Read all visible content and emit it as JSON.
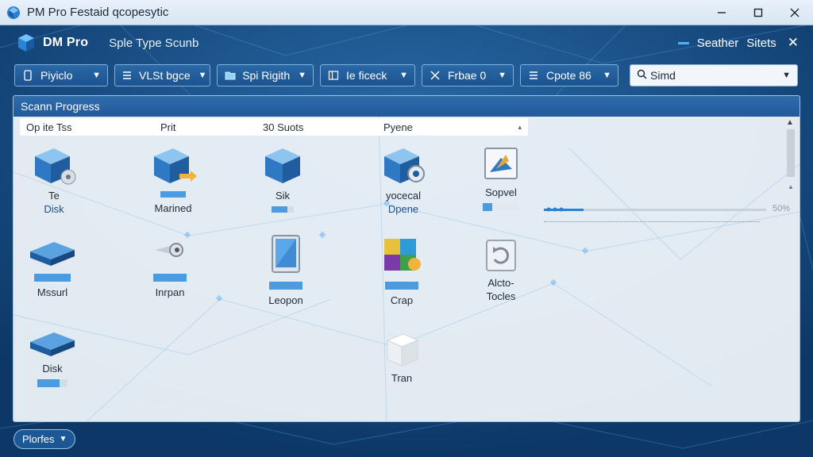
{
  "window": {
    "title": "PM Pro Festaid qcopesytic"
  },
  "header": {
    "brand": "DM Pro",
    "subtitle": "Sple Type Scunb",
    "right_item_1": "Seather",
    "right_item_2": "Sitets"
  },
  "toolbar": {
    "dropdowns": [
      {
        "label": "Piyiclo",
        "icon": "device-icon"
      },
      {
        "label": "VLSt bgce",
        "icon": "list-icon"
      },
      {
        "label": "Spi Rigith",
        "icon": "folder-icon"
      },
      {
        "label": "Ie ficeck",
        "icon": "panel-icon"
      },
      {
        "label": "Frbae 0",
        "icon": "tools-icon"
      },
      {
        "label": "Cpote 86",
        "icon": "list-icon"
      }
    ],
    "search": {
      "label": "Simd",
      "icon": "search-icon"
    }
  },
  "panel": {
    "title": "Scann Progress",
    "columns": [
      "Op ite Tss",
      "Prit",
      "30 Suots",
      "Pyene"
    ],
    "progress": {
      "percent_label": "50%",
      "fraction": 0.18
    },
    "items": {
      "r1c1_a": "Te",
      "r1c1_b": "Disk",
      "r1c2": "Marined",
      "r1c3": "Sik",
      "r1c4_a": "yocecal",
      "r1c4_b": "Dpene",
      "r1c5": "Sopvel",
      "r2c1": "Mssurl",
      "r2c2": "Inrpan",
      "r2c3": "Leopon",
      "r2c4": "Crap",
      "r2c5_a": "Alcto-",
      "r2c5_b": "Tocles",
      "r3c1": "Disk",
      "r3c4": "Tran"
    }
  },
  "footer": {
    "button": "Plorfes"
  },
  "colors": {
    "accent": "#2c7fd1",
    "header_blue": "#22599a",
    "background": "#0f3f72"
  }
}
